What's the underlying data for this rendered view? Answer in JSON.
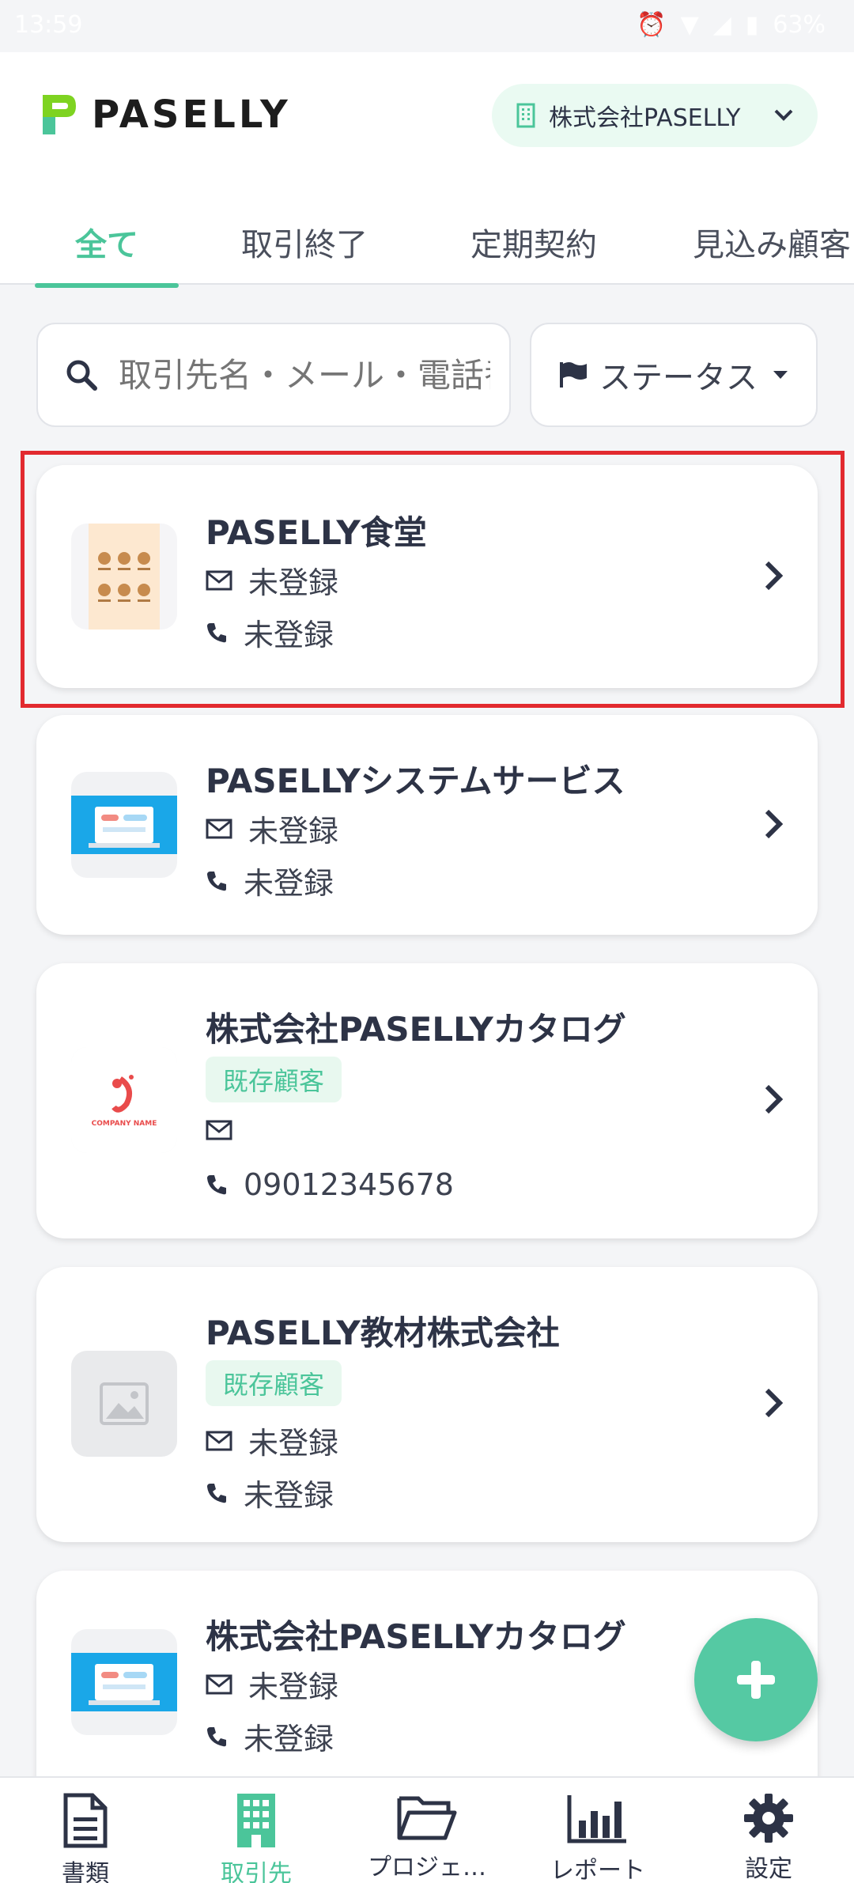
{
  "status_bar": {
    "time": "13:59",
    "battery": "63%"
  },
  "header": {
    "logo_text": "PASELLY",
    "company_selector": "株式会社PASELLY"
  },
  "tabs": [
    {
      "label": "全て",
      "active": true
    },
    {
      "label": "取引終了",
      "active": false
    },
    {
      "label": "定期契約",
      "active": false
    },
    {
      "label": "見込み顧客",
      "active": false
    }
  ],
  "search": {
    "placeholder": "取引先名・メール・電話番号"
  },
  "filter": {
    "label": "ステータス"
  },
  "clients": [
    {
      "name": "PASELLY食堂",
      "badge": null,
      "email": "未登録",
      "phone": "未登録",
      "thumb": "food-menu-image",
      "highlighted": true
    },
    {
      "name": "PASELLYシステムサービス",
      "badge": null,
      "email": "未登録",
      "phone": "未登録",
      "thumb": "laptop-banner-image"
    },
    {
      "name": "株式会社PASELLYカタログ",
      "badge": "既存顧客",
      "email": "",
      "phone": "09012345678",
      "thumb": "company-logo-image",
      "logo_caption": "COMPANY NAME"
    },
    {
      "name": "PASELLY教材株式会社",
      "badge": "既存顧客",
      "email": "未登録",
      "phone": "未登録",
      "thumb": "placeholder-image"
    },
    {
      "name": "株式会社PASELLYカタログ",
      "badge": null,
      "email": "未登録",
      "phone": "未登録",
      "thumb": "laptop-banner-image"
    }
  ],
  "bottom_nav": [
    {
      "label": "書類",
      "icon": "document-icon",
      "active": false
    },
    {
      "label": "取引先",
      "icon": "building-icon",
      "active": true
    },
    {
      "label": "プロジェ…",
      "icon": "folder-icon",
      "active": false
    },
    {
      "label": "レポート",
      "icon": "bar-chart-icon",
      "active": false
    },
    {
      "label": "設定",
      "icon": "gear-icon",
      "active": false
    }
  ],
  "colors": {
    "accent": "#4bc59a",
    "highlight": "#e22a2f",
    "text": "#2d3346"
  }
}
